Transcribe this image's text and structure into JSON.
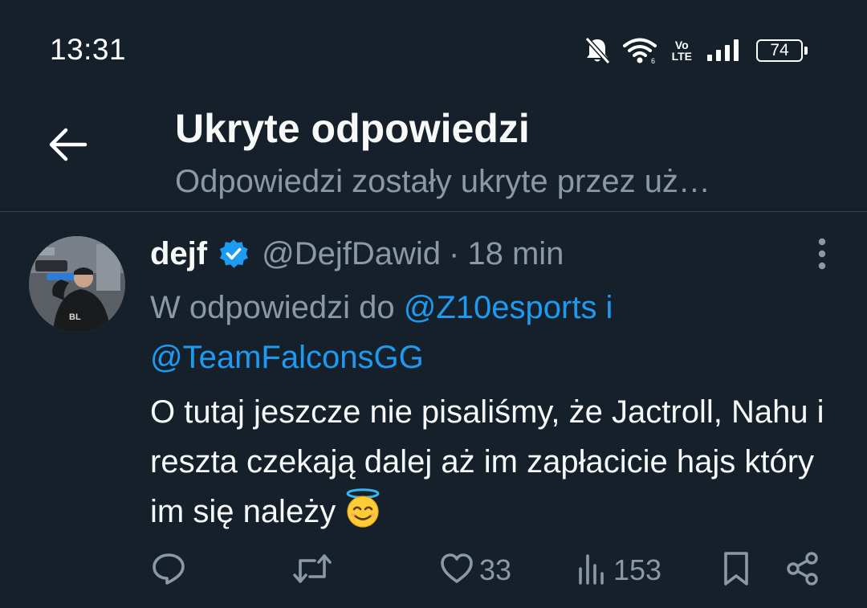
{
  "status_bar": {
    "time": "13:31",
    "icons": [
      "bell-off-icon",
      "wifi-icon",
      "volte-icon",
      "signal-icon",
      "battery-icon"
    ],
    "volte_top": "Vo",
    "volte_bottom": "LTE",
    "battery_level": "74"
  },
  "header": {
    "back_icon": "arrow-left-icon",
    "title": "Ukryte odpowiedzi",
    "subtitle": "Odpowiedzi zostały ukryte przez uż…"
  },
  "tweet": {
    "display_name": "dejf",
    "verified": true,
    "handle": "@DejfDawid",
    "separator": "·",
    "time": "18 min",
    "reply_prefix": "W odpowiedzi do ",
    "reply_mention_1": "@Z10esports",
    "reply_conjunction": " i",
    "reply_mention_2": "@TeamFalconsGG",
    "text": "O tutaj jeszcze nie pisaliśmy, że Jactroll, Nahu i reszta czekają dalej aż im zapłacicie hajs który im się należy",
    "emoji": "smiling-face-with-halo"
  },
  "actions": {
    "reply_icon": "reply-icon",
    "retweet_icon": "retweet-icon",
    "like_icon": "heart-icon",
    "like_count": "33",
    "views_icon": "views-icon",
    "views_count": "153",
    "bookmark_icon": "bookmark-icon",
    "share_icon": "share-icon"
  },
  "colors": {
    "background": "#15202b",
    "text_primary": "#f7f9f9",
    "text_secondary": "#8b98a5",
    "accent": "#1d9bf0",
    "divider": "#38444d"
  }
}
